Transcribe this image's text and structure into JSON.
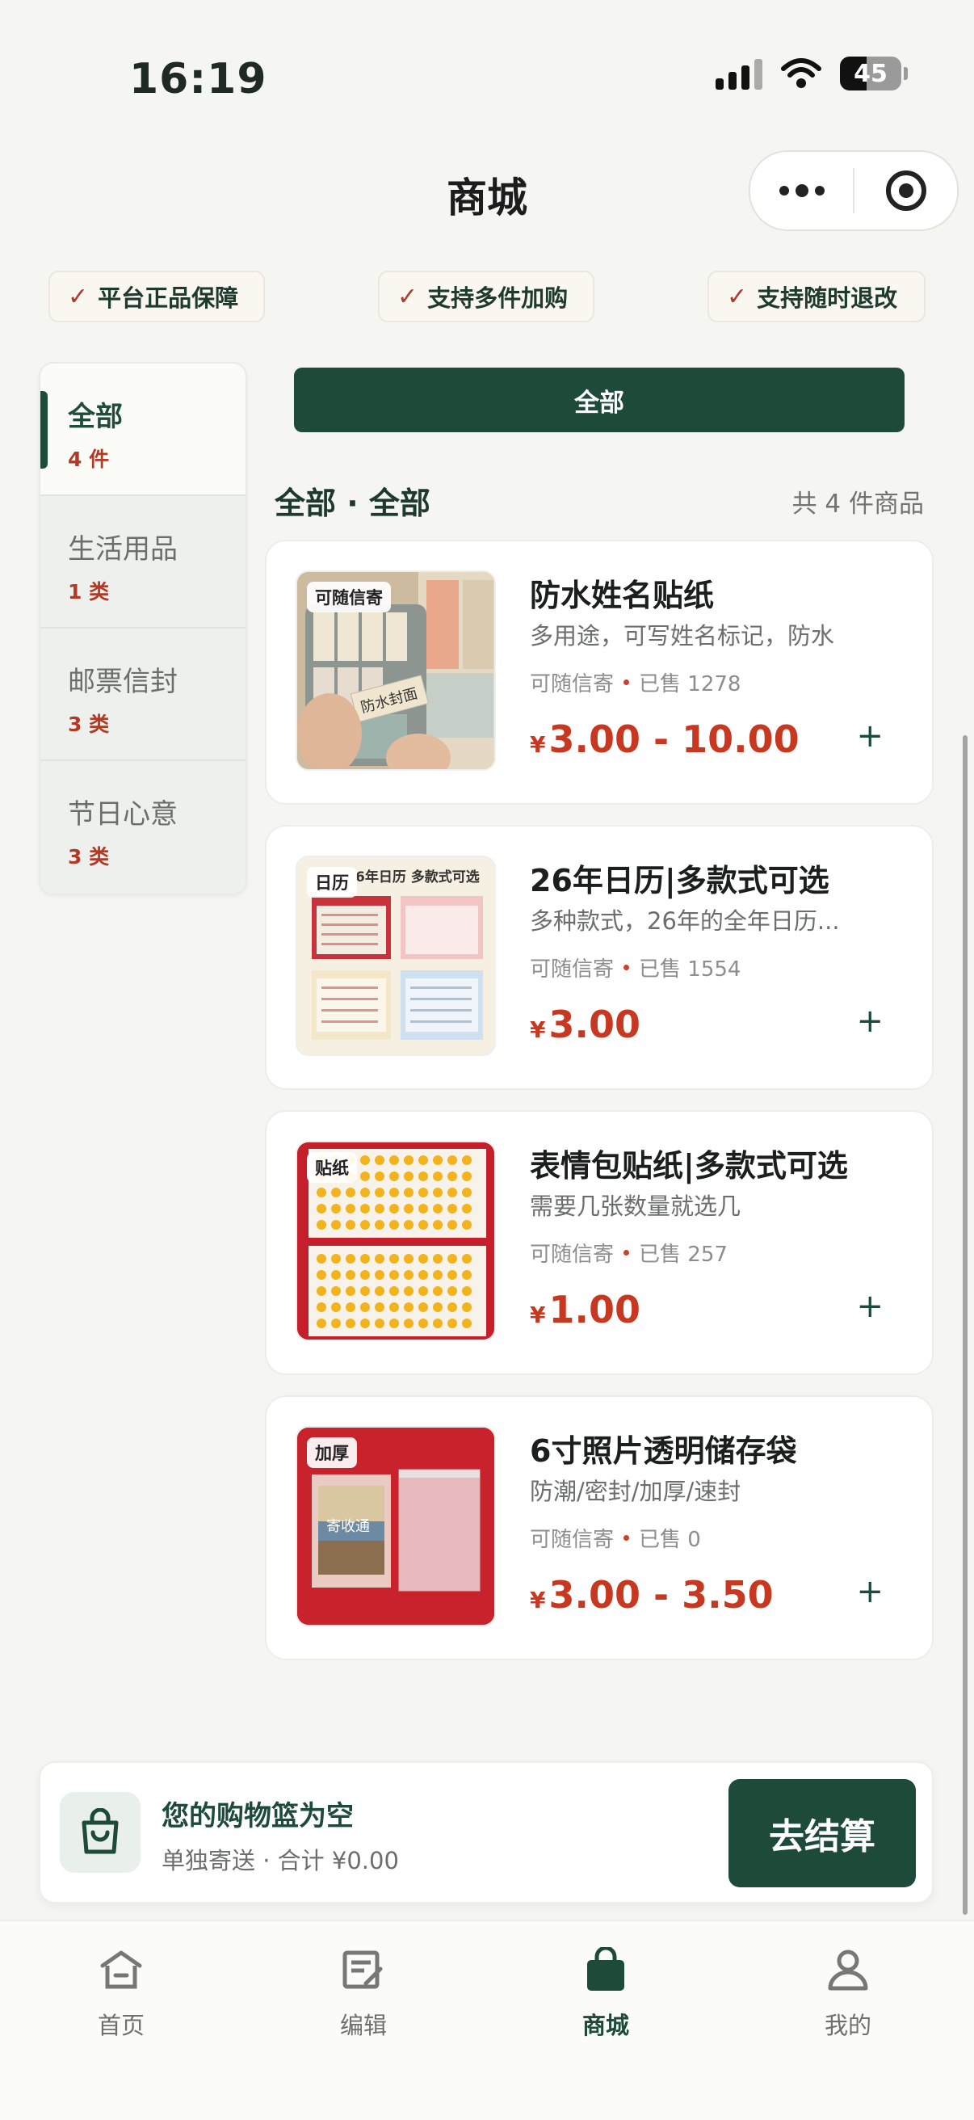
{
  "status_bar": {
    "time": "16:19",
    "battery": "45"
  },
  "header": {
    "title": "商城"
  },
  "guarantees": [
    "平台正品保障",
    "支持多件加购",
    "支持随时退改"
  ],
  "sidebar": {
    "items": [
      {
        "name": "全部",
        "count": "4 件"
      },
      {
        "name": "生活用品",
        "count": "1 类"
      },
      {
        "name": "邮票信封",
        "count": "3 类"
      },
      {
        "name": "节日心意",
        "count": "3 类"
      }
    ]
  },
  "main": {
    "filter_label": "全部",
    "section_title": "全部 · 全部",
    "total": "共 4 件商品",
    "products": [
      {
        "tag": "可随信寄",
        "name": "防水姓名贴纸",
        "desc": "多用途，可写姓名标记，防水",
        "ship": "可随信寄",
        "sold": "已售 1278",
        "currency": "¥",
        "price": "3.00 - 10.00",
        "add": "+"
      },
      {
        "tag": "日历",
        "name": "26年日历|多款式可选",
        "desc": "多种款式，26年的全年日历...",
        "ship": "可随信寄",
        "sold": "已售 1554",
        "currency": "¥",
        "price": "3.00",
        "add": "+"
      },
      {
        "tag": "贴纸",
        "name": "表情包贴纸|多款式可选",
        "desc": "需要几张数量就选几",
        "ship": "可随信寄",
        "sold": "已售 257",
        "currency": "¥",
        "price": "1.00",
        "add": "+"
      },
      {
        "tag": "加厚",
        "name": "6寸照片透明储存袋",
        "desc": "防潮/密封/加厚/速封",
        "ship": "可随信寄",
        "sold": "已售 0",
        "currency": "¥",
        "price": "3.00 - 3.50",
        "add": "+"
      }
    ],
    "thumb_texts": {
      "calendar_banner": "6年日历 多款式可选",
      "sticker_label": "防水封面",
      "photo_label": "寄收通"
    }
  },
  "cart": {
    "title": "您的购物篮为空",
    "subtitle": "单独寄送 · 合计 ¥0.00",
    "checkout": "去结算"
  },
  "tabbar": [
    {
      "label": "首页",
      "icon": "home-icon"
    },
    {
      "label": "编辑",
      "icon": "edit-icon"
    },
    {
      "label": "商城",
      "icon": "shop-bag-icon"
    },
    {
      "label": "我的",
      "icon": "user-icon"
    }
  ],
  "colors": {
    "primary": "#1e4a3a",
    "price": "#c8371f",
    "accent": "#b33a2a"
  }
}
